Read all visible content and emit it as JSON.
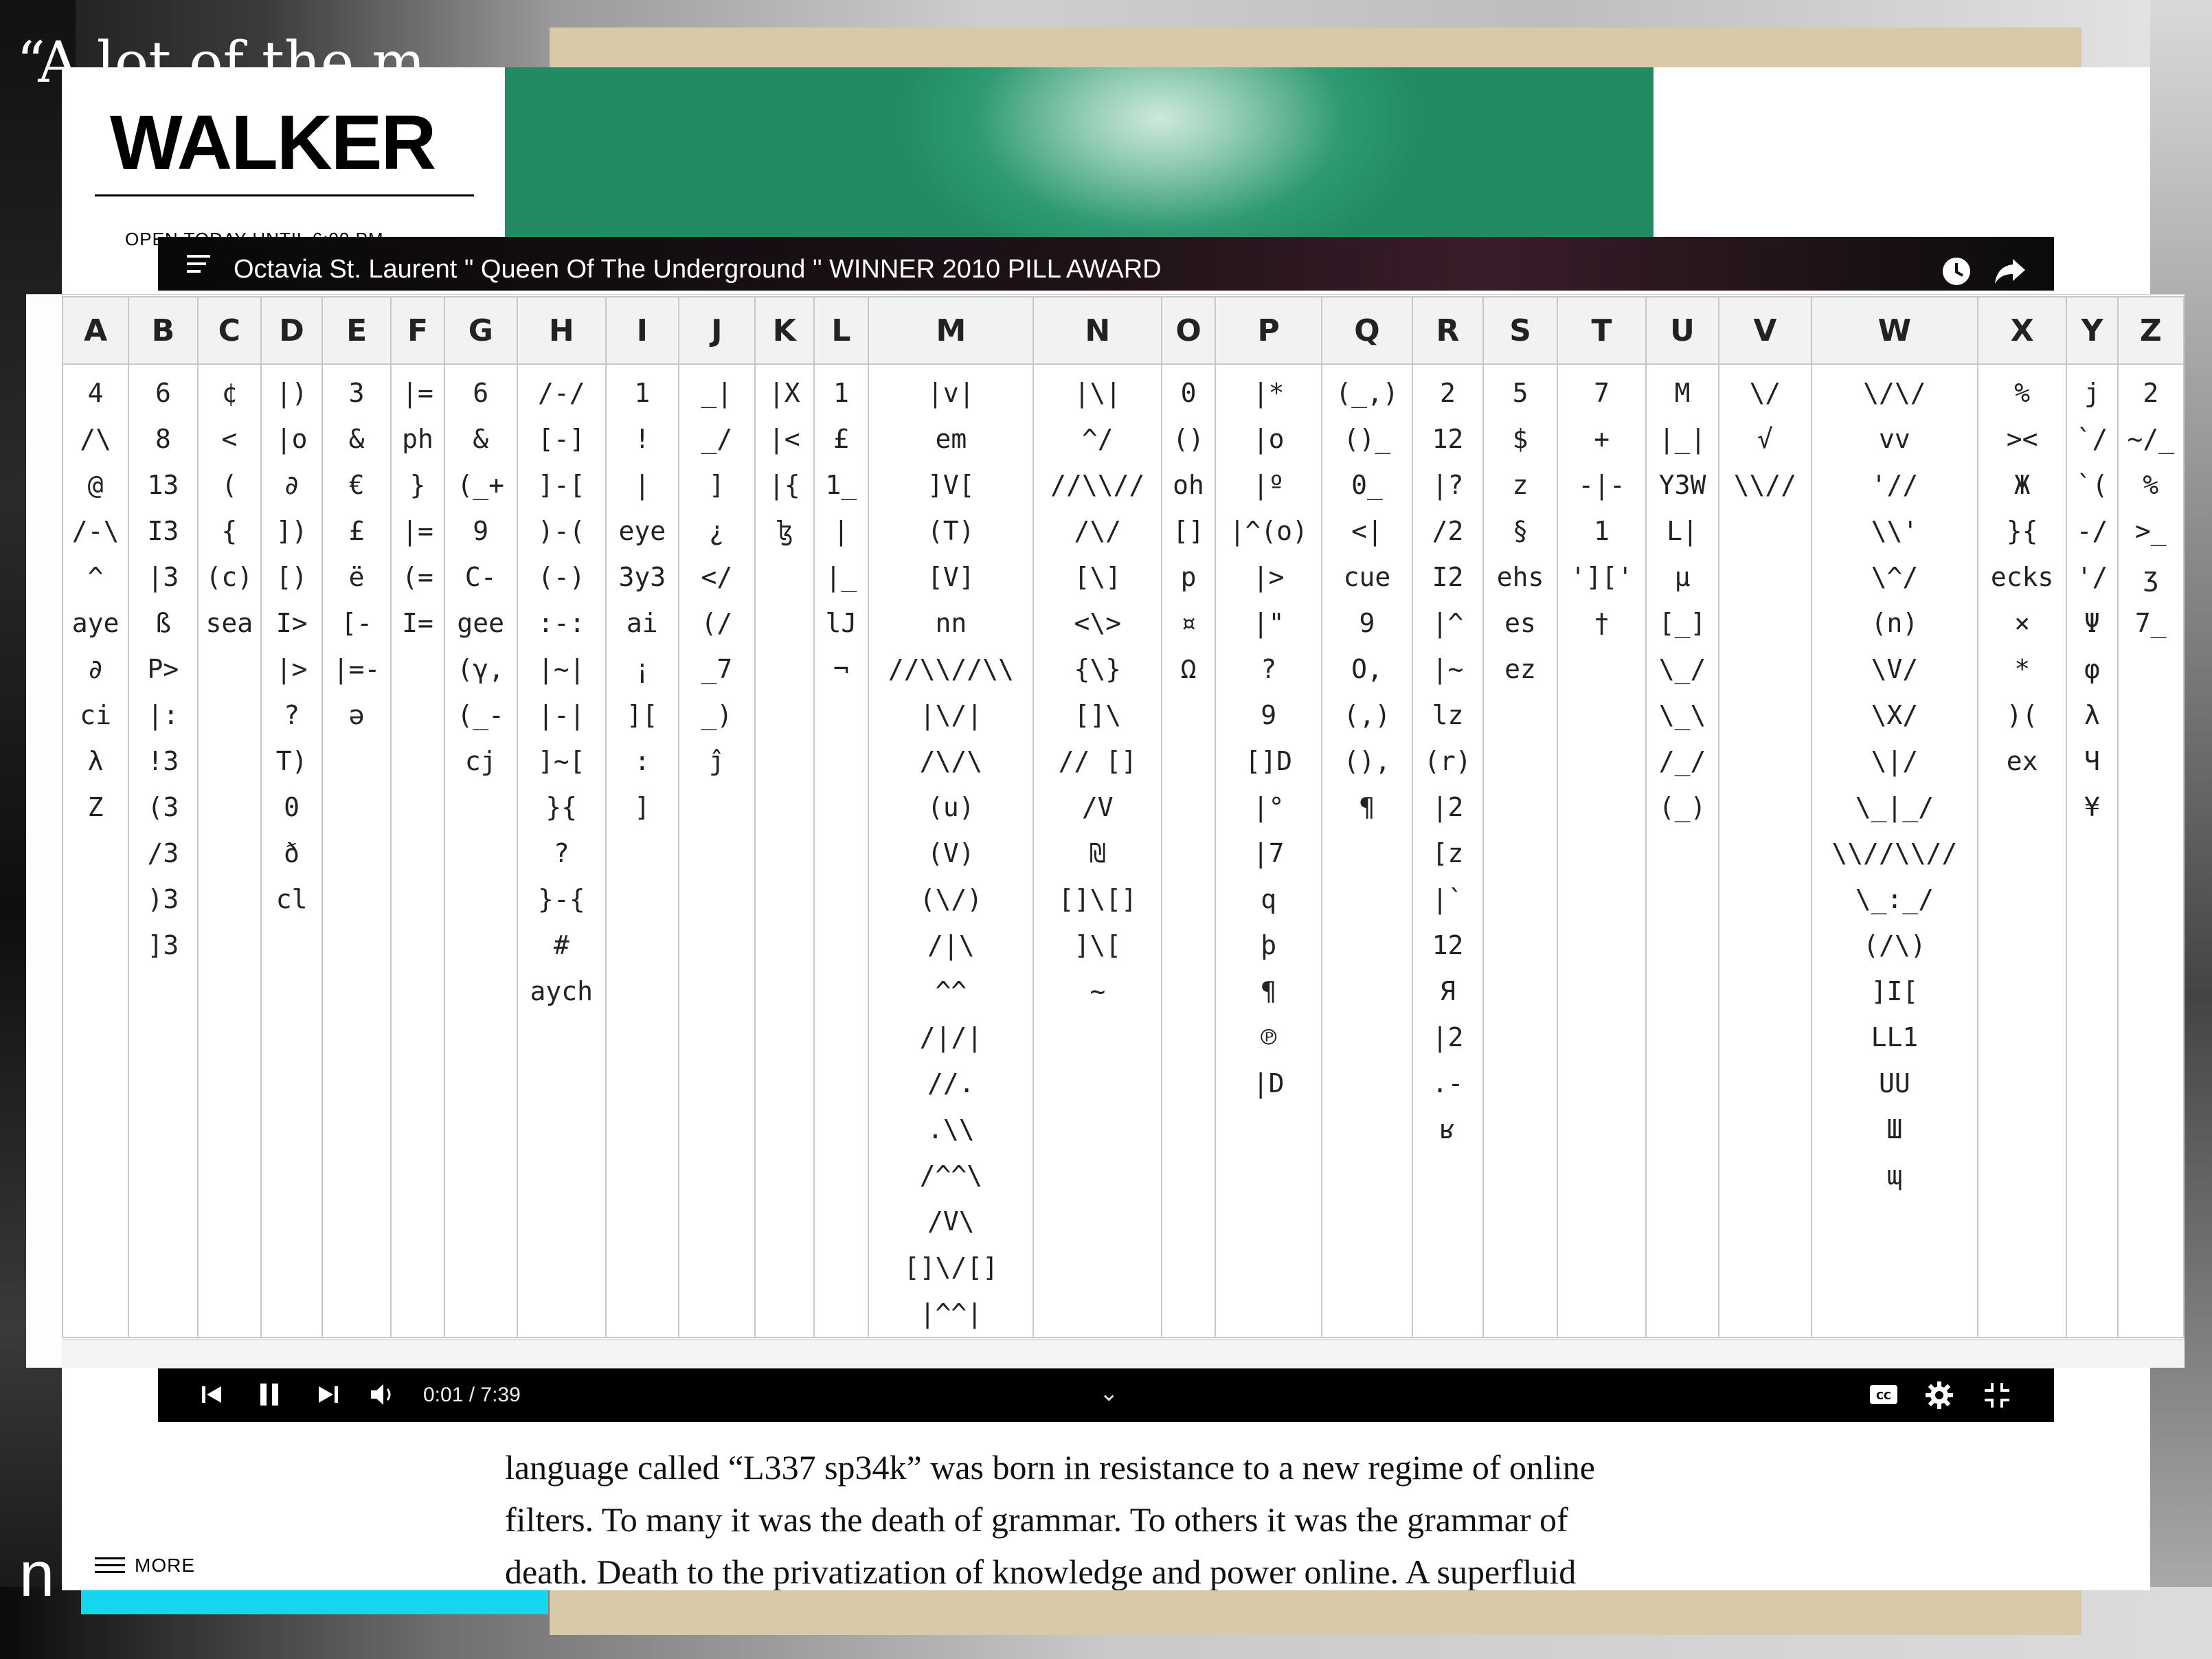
{
  "background": {
    "quote_fragment": "“A lot of the m",
    "bottom_left_letter": "n"
  },
  "walker": {
    "logo": "WALKER",
    "open_today": "OPEN TODAY UNTIL 6:00 PM",
    "more_label": "MORE",
    "article_lines": [
      "language called “L337 sp34k” was born in resistance to a new regime of online",
      "filters. To many it was the death of grammar. To others it was the grammar of",
      "death. Death to the privatization of knowledge and power online. A superfluid"
    ]
  },
  "video": {
    "title": "Octavia St. Laurent \" Queen Of The Underground \" WINNER 2010 PILL AWARD",
    "time": "0:01 / 7:39",
    "icons": [
      "playlist-icon",
      "clock-icon",
      "share-icon",
      "skip-previous-icon",
      "pause-icon",
      "skip-next-icon",
      "volume-icon",
      "chevron-down-icon",
      "captions-icon",
      "settings-icon",
      "exit-fullscreen-icon"
    ]
  },
  "leet_table": {
    "columns": [
      {
        "letter": "A",
        "entries": [
          "4",
          "/\\",
          "@",
          "/-\\",
          "^",
          "aye",
          "∂",
          "ci",
          "λ",
          "Z"
        ]
      },
      {
        "letter": "B",
        "entries": [
          "6",
          "8",
          "13",
          "I3",
          "|3",
          "ß",
          "P>",
          "|:",
          "!3",
          "(3",
          "/3",
          ")3",
          "]3"
        ]
      },
      {
        "letter": "C",
        "entries": [
          "¢",
          "<",
          "(",
          "{",
          "(c)",
          "sea"
        ]
      },
      {
        "letter": "D",
        "entries": [
          "|)",
          "|o",
          "∂",
          "])",
          "[)",
          "I>",
          "|>",
          "?",
          "T)",
          "0",
          "ð",
          "cl"
        ]
      },
      {
        "letter": "E",
        "entries": [
          "3",
          "&",
          "€",
          "£",
          "ë",
          "[-",
          "|=-",
          "ə"
        ]
      },
      {
        "letter": "F",
        "entries": [
          "|=",
          "ph",
          "}",
          "|=",
          "(=",
          "I="
        ]
      },
      {
        "letter": "G",
        "entries": [
          "6",
          "&",
          "(_+",
          "9",
          "C-",
          "gee",
          "(γ,",
          "(_-",
          "cj"
        ]
      },
      {
        "letter": "H",
        "entries": [
          "/-/",
          "[-]",
          "]-[",
          ")-(",
          "(-)",
          ":-:",
          "|~|",
          "|-|",
          "]~[",
          "}{",
          "?",
          "}-{",
          "#",
          "aych"
        ]
      },
      {
        "letter": "I",
        "entries": [
          "1",
          "!",
          "|",
          "eye",
          "3y3",
          "ai",
          "¡",
          "][",
          ":",
          "]"
        ]
      },
      {
        "letter": "J",
        "entries": [
          "_|",
          "_/",
          "]",
          "¿",
          "</",
          "(/",
          "_7",
          "_)",
          "ĵ"
        ]
      },
      {
        "letter": "K",
        "entries": [
          "|X",
          "|<",
          "|{",
          "ɮ"
        ]
      },
      {
        "letter": "L",
        "entries": [
          "1",
          "£",
          "1_",
          "|",
          "|_",
          "lJ",
          "¬"
        ]
      },
      {
        "letter": "M",
        "entries": [
          "|v|",
          "em",
          "]V[",
          "(T)",
          "[V]",
          "nn",
          "//\\\\//\\\\",
          "|\\/|",
          "/\\/\\",
          "(u)",
          "(V)",
          "(\\/)",
          "/|\\",
          "^^",
          "/|/|",
          "//.",
          ".\\\\",
          "/^^\\",
          "/V\\",
          "[]\\/[]",
          "|^^|"
        ]
      },
      {
        "letter": "N",
        "entries": [
          "|\\|",
          "^/",
          "//\\\\//",
          "/\\/",
          "[\\]",
          "<\\>",
          "{\\}",
          "[]\\",
          "// []",
          "/V",
          "₪",
          "[]\\[]",
          "]\\[",
          "~"
        ]
      },
      {
        "letter": "O",
        "entries": [
          "0",
          "()",
          "oh",
          "[]",
          "p",
          "¤",
          "Ω"
        ]
      },
      {
        "letter": "P",
        "entries": [
          "|*",
          "|o",
          "|º",
          "|^(o)",
          "|>",
          "|\"",
          "?",
          "9",
          "[]D",
          "|°",
          "|7",
          "q",
          "þ",
          "¶",
          "℗",
          "|D"
        ]
      },
      {
        "letter": "Q",
        "entries": [
          "(_,)",
          "()_",
          "0_",
          "<|",
          "cue",
          "9",
          "O,",
          "(,)",
          "(),",
          "¶"
        ]
      },
      {
        "letter": "R",
        "entries": [
          "2",
          "12",
          "|?",
          "/2",
          "I2",
          "|^",
          "|~",
          "lz",
          "(r)",
          "|2",
          "[z",
          "|`",
          "12",
          "Я",
          "|2",
          ".-",
          "ʁ"
        ]
      },
      {
        "letter": "S",
        "entries": [
          "5",
          "$",
          "z",
          "§",
          "ehs",
          "es",
          "ez"
        ]
      },
      {
        "letter": "T",
        "entries": [
          "7",
          "+",
          "-|-",
          "1",
          "']['",
          "†"
        ]
      },
      {
        "letter": "U",
        "entries": [
          "M",
          "|_|",
          "Y3W",
          "L|",
          "µ",
          "[_]",
          "\\_/",
          "\\_\\",
          "/_/",
          "(_)"
        ]
      },
      {
        "letter": "V",
        "entries": [
          "\\/",
          "√",
          "\\\\//"
        ]
      },
      {
        "letter": "W",
        "entries": [
          "\\/\\/",
          "vv",
          "'//",
          "\\\\'",
          "\\^/",
          "(n)",
          "\\V/",
          "\\X/",
          "\\|/",
          "\\_|_/",
          "\\\\//\\\\//",
          "\\_:_/",
          "(/\\)",
          "]I[",
          "LL1",
          "UU",
          "Ш",
          "ɰ"
        ]
      },
      {
        "letter": "X",
        "entries": [
          "%",
          "><",
          "Ж",
          "}{",
          "ecks",
          "×",
          "*",
          ")(",
          "ex"
        ]
      },
      {
        "letter": "Y",
        "entries": [
          "j",
          "`/",
          "`(",
          "-/",
          "'/",
          "Ψ",
          "φ",
          "λ",
          "Ч",
          "¥"
        ]
      },
      {
        "letter": "Z",
        "entries": [
          "2",
          "~/_",
          "%",
          ">_",
          "ʒ",
          "7_"
        ]
      }
    ]
  }
}
